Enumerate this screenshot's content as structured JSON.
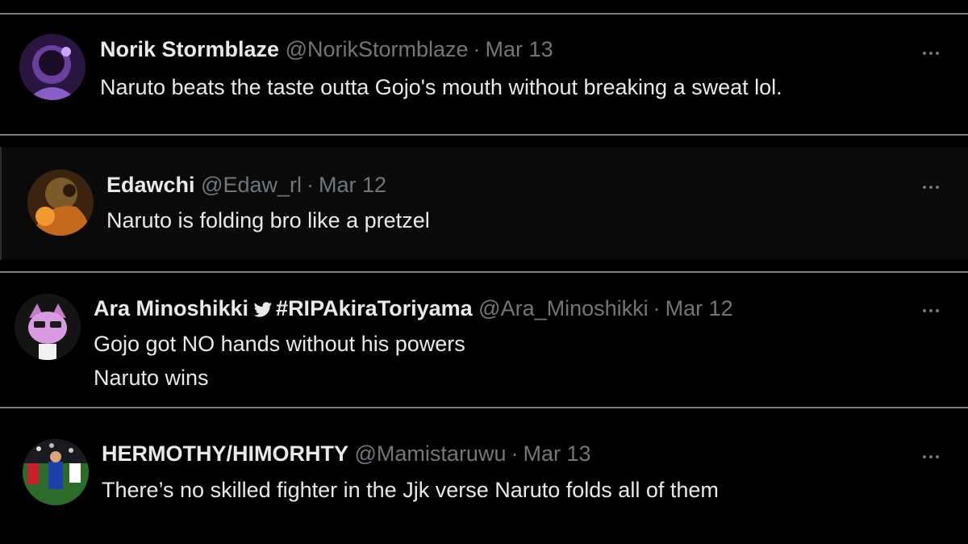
{
  "tweets": [
    {
      "name": "Norik Stormblaze",
      "handle": "@NorikStormblaze",
      "separator": "·",
      "date": "Mar 13",
      "lines": [
        "Naruto beats the taste outta Gojo's mouth without breaking a sweat lol."
      ],
      "avatar": "purple-portrait-avatar"
    },
    {
      "name": "Edawchi",
      "handle": "@Edaw_rl",
      "separator": "·",
      "date": "Mar 12",
      "lines": [
        "Naruto is folding bro like a pretzel"
      ],
      "avatar": "orange-portrait-avatar"
    },
    {
      "name": "Ara Minoshikki",
      "name_suffix": "#RIPAkiraToriyama",
      "handle": "@Ara_Minoshikki",
      "separator": "·",
      "date": "Mar 12",
      "lines": [
        "Gojo got NO hands without his powers",
        "Naruto wins"
      ],
      "avatar": "pink-cartoon-avatar"
    },
    {
      "name": "HERMOTHY/HIMORHTY",
      "handle": "@Mamistaruwu",
      "separator": "·",
      "date": "Mar 13",
      "lines": [
        "There’s no skilled fighter in the Jjk verse Naruto folds all of them"
      ],
      "avatar": "soccer-photo-avatar"
    }
  ],
  "icons": {
    "more": "more-options-icon",
    "bird": "bird-icon"
  },
  "colors": {
    "background": "#000000",
    "text": "#e7e9ea",
    "muted": "#71767b",
    "separator": "#7a7d82"
  }
}
